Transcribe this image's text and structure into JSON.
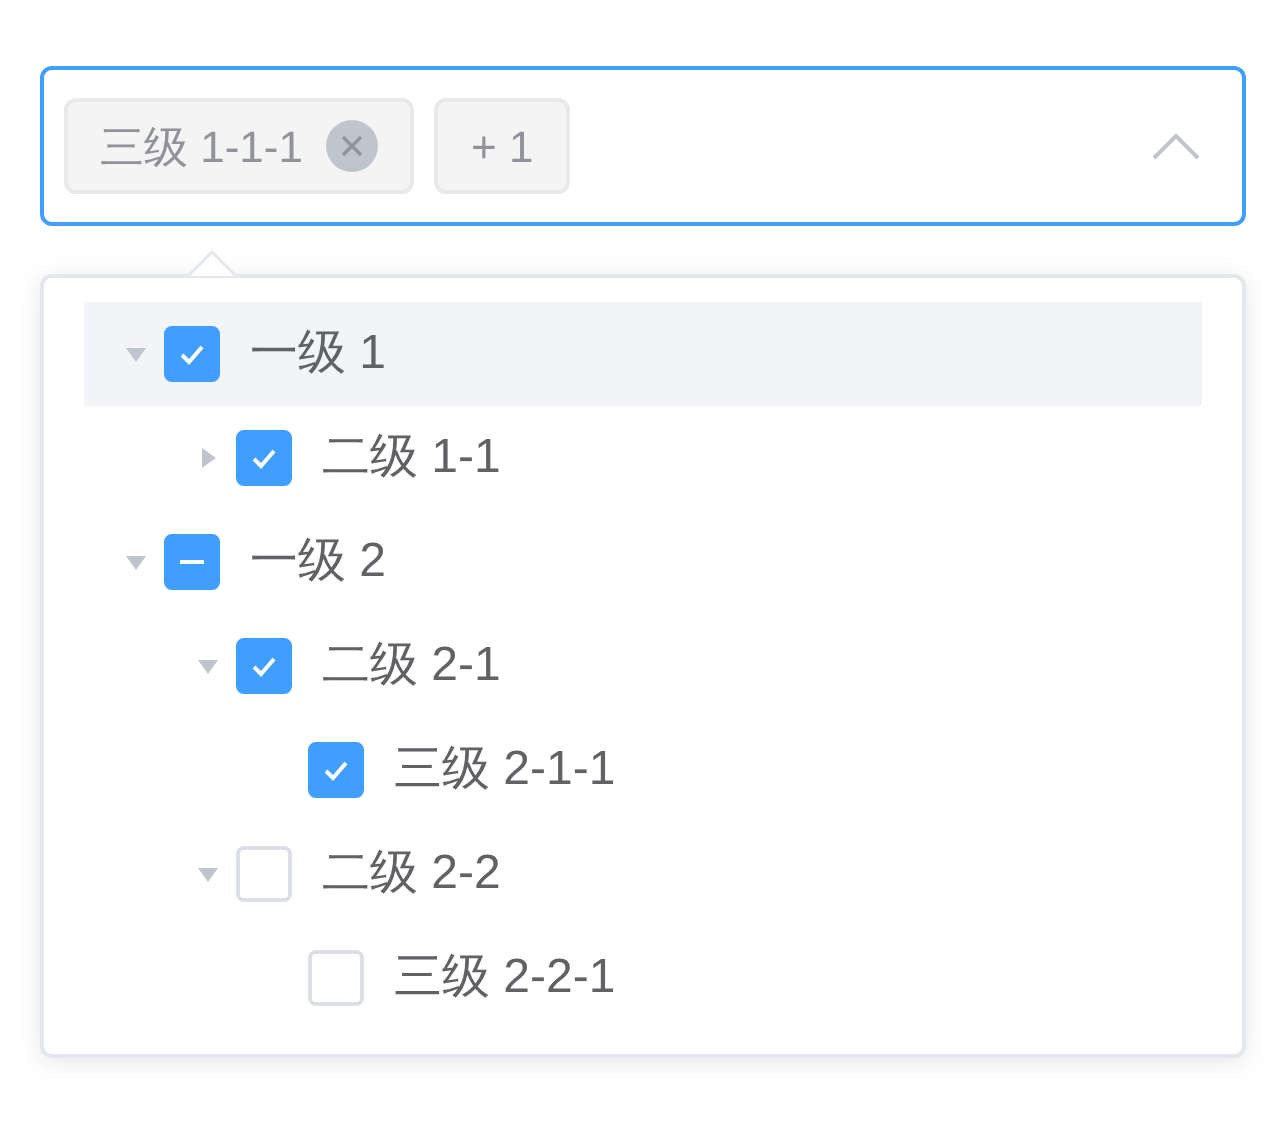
{
  "select": {
    "focused": true,
    "expanded": true,
    "tags": [
      {
        "label": "三级 1-1-1",
        "kind": "closable"
      },
      {
        "label": "+ 1",
        "kind": "count"
      }
    ]
  },
  "tree": [
    {
      "label": "一级 1",
      "expandable": true,
      "expanded": true,
      "checked": true,
      "indeterminate": false,
      "highlighted": true,
      "children": [
        {
          "label": "二级 1-1",
          "expandable": true,
          "expanded": false,
          "checked": true,
          "indeterminate": false,
          "highlighted": false
        }
      ]
    },
    {
      "label": "一级 2",
      "expandable": true,
      "expanded": true,
      "checked": false,
      "indeterminate": true,
      "highlighted": false,
      "children": [
        {
          "label": "二级 2-1",
          "expandable": true,
          "expanded": true,
          "checked": true,
          "indeterminate": false,
          "highlighted": false,
          "children": [
            {
              "label": "三级 2-1-1",
              "expandable": false,
              "expanded": false,
              "checked": true,
              "indeterminate": false,
              "highlighted": false
            }
          ]
        },
        {
          "label": "二级 2-2",
          "expandable": true,
          "expanded": true,
          "checked": false,
          "indeterminate": false,
          "highlighted": false,
          "children": [
            {
              "label": "三级 2-2-1",
              "expandable": false,
              "expanded": false,
              "checked": false,
              "indeterminate": false,
              "highlighted": false
            }
          ]
        }
      ]
    }
  ]
}
